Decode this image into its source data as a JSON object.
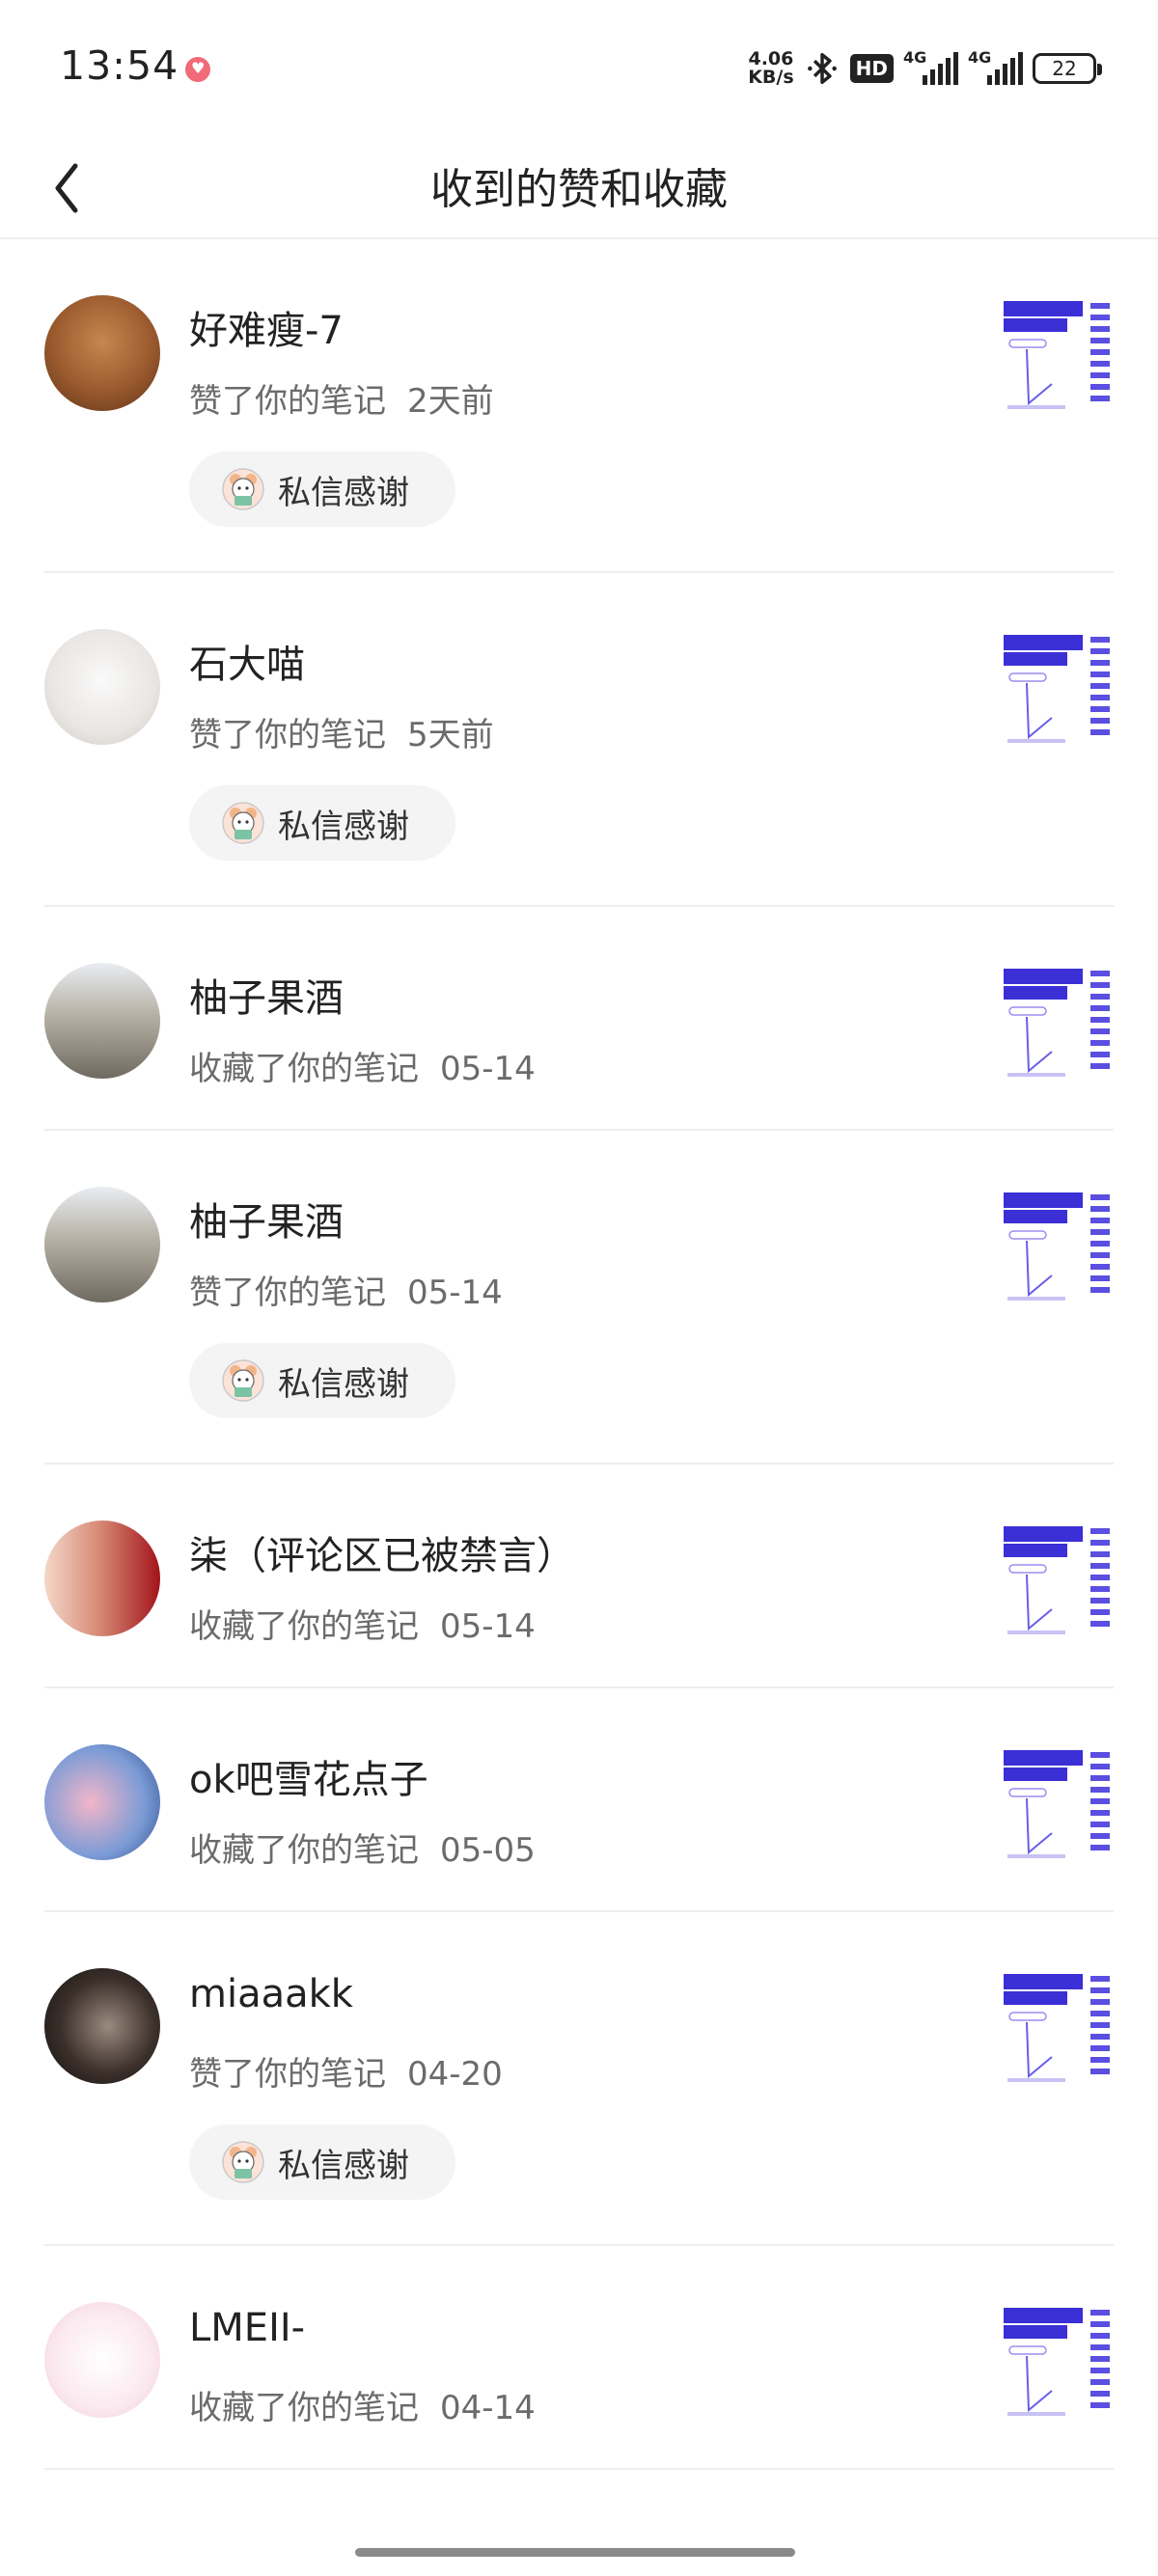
{
  "status_bar": {
    "time": "13:54",
    "speed_value": "4.06",
    "speed_unit": "KB/s",
    "hd_badge": "HD",
    "network1": "4G",
    "network2": "4G",
    "battery": "22"
  },
  "header": {
    "back_icon": "chevron-left-icon",
    "title": "收到的赞和收藏"
  },
  "thank_button_label": "私信感谢",
  "items": [
    {
      "name": "好难瘦-7",
      "action": "赞了你的笔记",
      "time": "2天前",
      "has_thank": true
    },
    {
      "name": "石大喵",
      "action": "赞了你的笔记",
      "time": "5天前",
      "has_thank": true
    },
    {
      "name": "柚子果酒",
      "action": "收藏了你的笔记",
      "time": "05-14",
      "has_thank": false
    },
    {
      "name": "柚子果酒",
      "action": "赞了你的笔记",
      "time": "05-14",
      "has_thank": true
    },
    {
      "name": "柒（评论区已被禁言）",
      "action": "收藏了你的笔记",
      "time": "05-14",
      "has_thank": false
    },
    {
      "name": "ok吧雪花点子",
      "action": "收藏了你的笔记",
      "time": "05-05",
      "has_thank": false
    },
    {
      "name": "miaaakk",
      "action": "赞了你的笔记",
      "time": "04-20",
      "has_thank": true
    },
    {
      "name": "LMEII-",
      "action": "收藏了你的笔记",
      "time": "04-14",
      "has_thank": false
    }
  ],
  "colors": {
    "accent_thumb": "#3b2fd6",
    "sub_text": "#6b6b6b",
    "pill_bg": "#f4f4f4"
  }
}
